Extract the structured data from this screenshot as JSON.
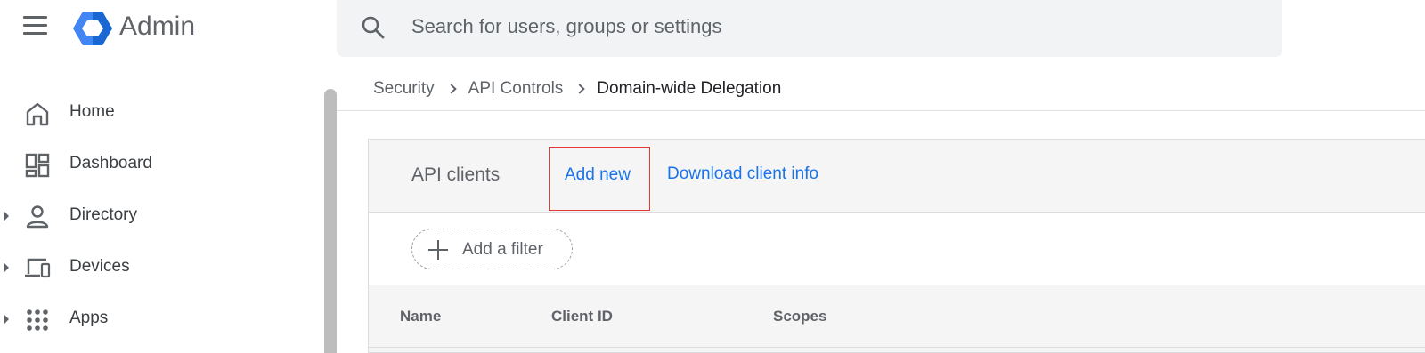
{
  "header": {
    "app_title": "Admin",
    "menu_icon": "hamburger-menu-icon",
    "logo_icon": "google-admin-hexagon-logo",
    "search": {
      "placeholder": "Search for users, groups or settings",
      "value": "",
      "icon": "search-icon"
    }
  },
  "sidebar": {
    "items": [
      {
        "label": "Home",
        "icon": "home-icon",
        "expandable": false
      },
      {
        "label": "Dashboard",
        "icon": "dashboard-icon",
        "expandable": false
      },
      {
        "label": "Directory",
        "icon": "person-icon",
        "expandable": true
      },
      {
        "label": "Devices",
        "icon": "devices-icon",
        "expandable": true
      },
      {
        "label": "Apps",
        "icon": "apps-grid-icon",
        "expandable": true
      }
    ]
  },
  "breadcrumb": [
    "Security",
    "API Controls",
    "Domain-wide Delegation"
  ],
  "panel": {
    "title": "API clients",
    "add_new_label": "Add new",
    "download_label": "Download client info",
    "filter_label": "Add a filter",
    "columns": [
      "Name",
      "Client ID",
      "Scopes"
    ]
  },
  "colors": {
    "link": "#1a73e8",
    "highlight_box": "#e53935",
    "panel_bg": "#f5f5f5",
    "search_bg": "#f1f3f4"
  }
}
